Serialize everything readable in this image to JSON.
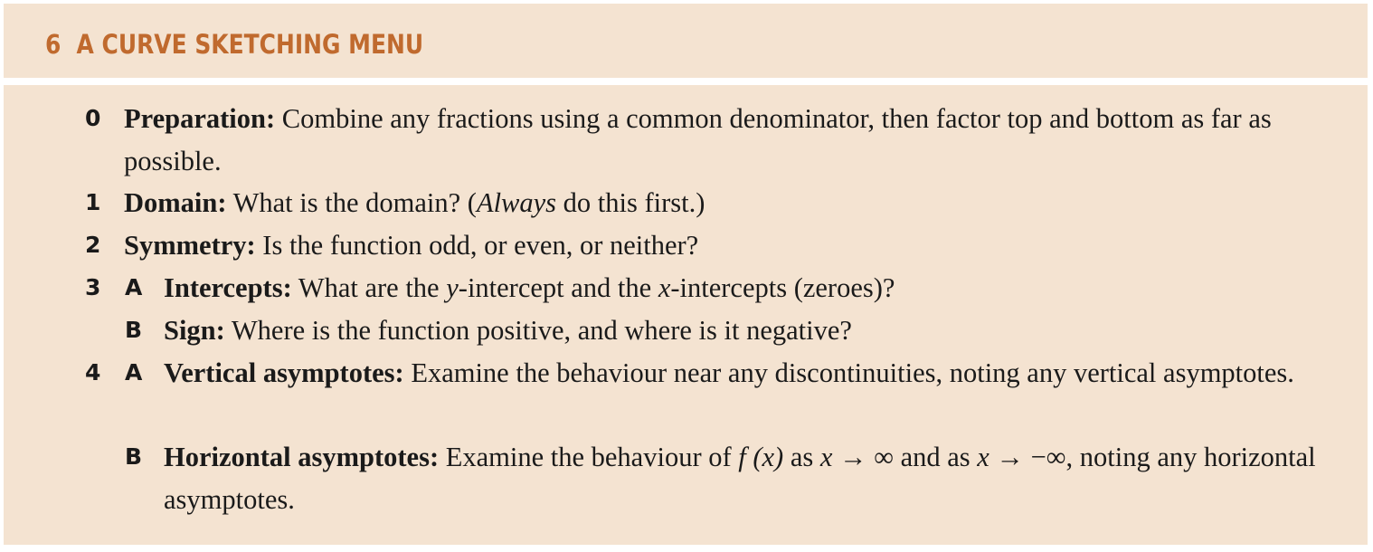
{
  "header": {
    "section_number": "6",
    "title": "A CURVE SKETCHING MENU"
  },
  "items": [
    {
      "number": "0",
      "term": "Preparation:",
      "text": " Combine any fractions using a common denominator, then factor top and bottom as far as possible."
    },
    {
      "number": "1",
      "term": "Domain:",
      "text_before": " What is the domain? (",
      "text_italic": "Always",
      "text_after": " do this first.)"
    },
    {
      "number": "2",
      "term": "Symmetry:",
      "text": " Is the function odd, or even, or neither?"
    },
    {
      "number": "3",
      "sub": "A",
      "term": "Intercepts:",
      "text_a": " What are the ",
      "var_y": "y",
      "text_b": "-intercept and the ",
      "var_x": "x",
      "text_c": "-intercepts (zeroes)?"
    },
    {
      "sub": "B",
      "term": "Sign:",
      "text": " Where is the function positive, and where is it negative?"
    },
    {
      "number": "4",
      "sub": "A",
      "term": "Vertical asymptotes:",
      "text": " Examine the behaviour near any discontinuities, noting any vertical asymptotes."
    },
    {
      "sub": "B",
      "term": "Horizontal asymptotes:",
      "text_a": " Examine the behaviour of ",
      "fx": "f (x)",
      "text_b": " as ",
      "var_x1": "x",
      "arrow1": " → ∞",
      "text_c": " and as ",
      "var_x2": "x",
      "arrow2": " → −∞",
      "text_d": ", noting any horizontal asymptotes."
    }
  ]
}
